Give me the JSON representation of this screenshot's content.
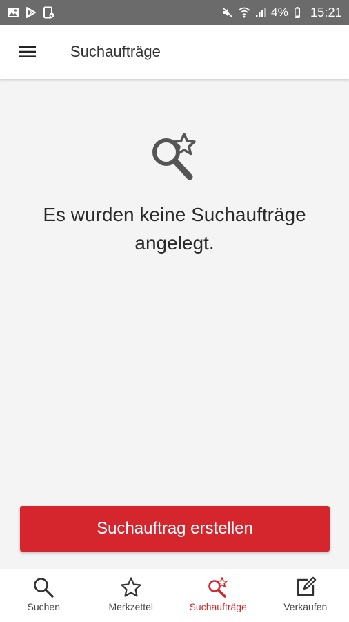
{
  "status_bar": {
    "battery_percent": "4%",
    "time": "15:21",
    "icons_left": [
      "image-icon",
      "play-store-icon",
      "device-icon"
    ],
    "icons_right": [
      "mute-icon",
      "wifi-icon",
      "signal-icon",
      "battery-icon"
    ]
  },
  "app_bar": {
    "title": "Suchaufträge",
    "menu_icon": "hamburger-menu-icon"
  },
  "empty_state": {
    "icon": "search-star-icon",
    "message": "Es wurden keine Suchaufträge angelegt."
  },
  "primary_action": {
    "label": "Suchauftrag erstellen"
  },
  "bottom_nav": {
    "items": [
      {
        "label": "Suchen",
        "icon": "search-icon",
        "active": false
      },
      {
        "label": "Merkzettel",
        "icon": "star-icon",
        "active": false
      },
      {
        "label": "Suchaufträge",
        "icon": "search-star-icon",
        "active": true
      },
      {
        "label": "Verkaufen",
        "icon": "edit-icon",
        "active": false
      }
    ]
  },
  "colors": {
    "accent": "#d5262d",
    "status_bar": "#6b6b6b",
    "background": "#f4f4f4",
    "icon_gray": "#555555"
  }
}
